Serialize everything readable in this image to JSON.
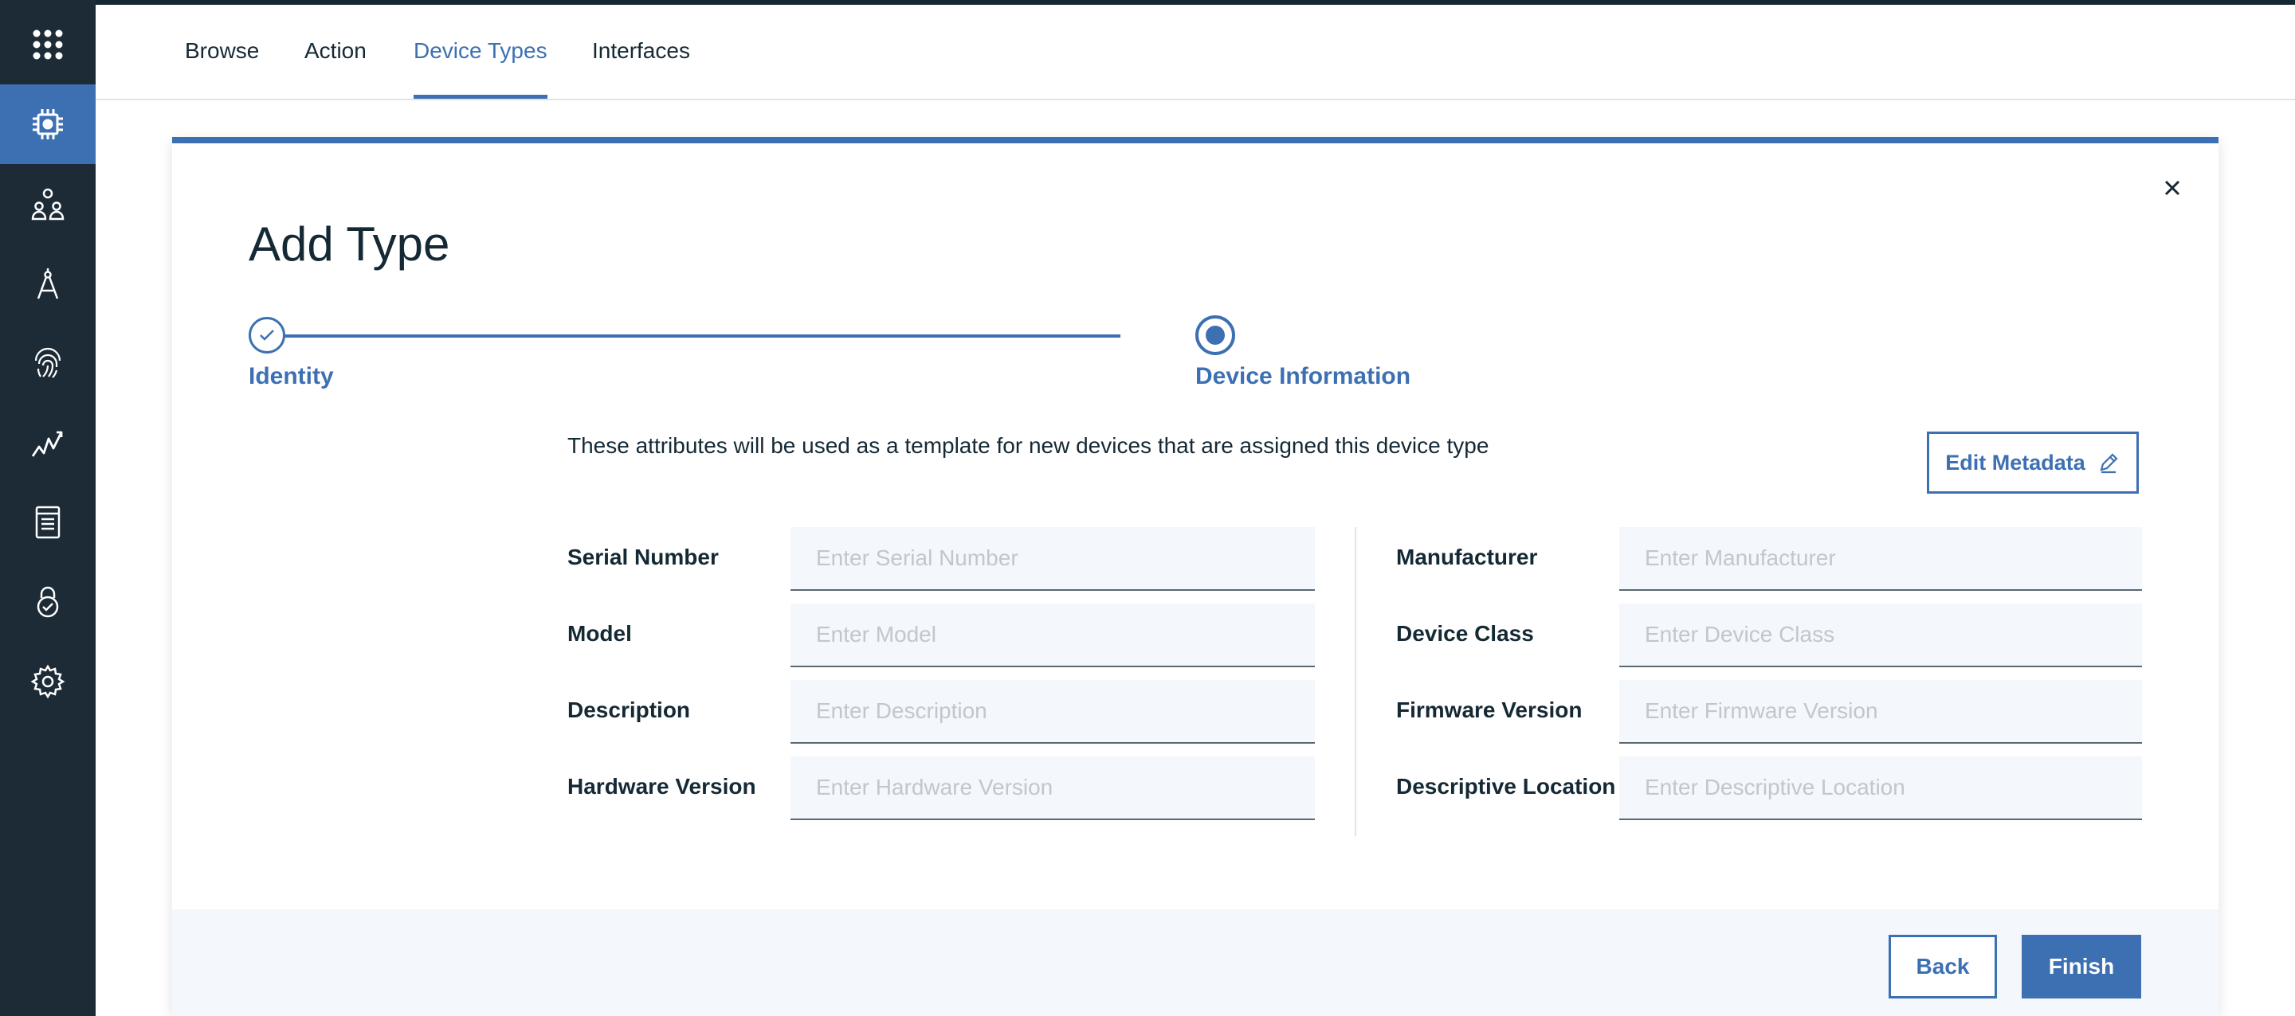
{
  "sidebar": {
    "items": [
      {
        "icon": "app-grid-icon"
      },
      {
        "icon": "chip-icon",
        "active": true
      },
      {
        "icon": "members-icon"
      },
      {
        "icon": "compass-icon"
      },
      {
        "icon": "fingerprint-icon"
      },
      {
        "icon": "analytics-icon"
      },
      {
        "icon": "document-icon"
      },
      {
        "icon": "security-lock-icon"
      },
      {
        "icon": "settings-gear-icon"
      }
    ]
  },
  "tabs": {
    "browse": "Browse",
    "action": "Action",
    "device_types": "Device Types",
    "interfaces": "Interfaces",
    "active": "Device Types"
  },
  "modal": {
    "title": "Add Type",
    "steps": {
      "identity": "Identity",
      "device_information": "Device Information",
      "current": "Device Information"
    },
    "description": "These attributes will be used as a template for new devices that are assigned this device type",
    "edit_metadata_label": "Edit Metadata",
    "fields": {
      "serial_number": {
        "label": "Serial Number",
        "placeholder": "Enter Serial Number",
        "value": ""
      },
      "model": {
        "label": "Model",
        "placeholder": "Enter Model",
        "value": ""
      },
      "description": {
        "label": "Description",
        "placeholder": "Enter Description",
        "value": ""
      },
      "hardware_version": {
        "label": "Hardware Version",
        "placeholder": "Enter Hardware Version",
        "value": ""
      },
      "manufacturer": {
        "label": "Manufacturer",
        "placeholder": "Enter Manufacturer",
        "value": ""
      },
      "device_class": {
        "label": "Device Class",
        "placeholder": "Enter Device Class",
        "value": ""
      },
      "firmware_version": {
        "label": "Firmware Version",
        "placeholder": "Enter Firmware Version",
        "value": ""
      },
      "descriptive_location": {
        "label": "Descriptive Location",
        "placeholder": "Enter Descriptive Location",
        "value": ""
      }
    },
    "back_label": "Back",
    "finish_label": "Finish"
  },
  "colors": {
    "accent": "#3d70b2",
    "sidebar_bg": "#1c2b36",
    "text": "#152935",
    "input_bg": "#f4f7fb"
  }
}
